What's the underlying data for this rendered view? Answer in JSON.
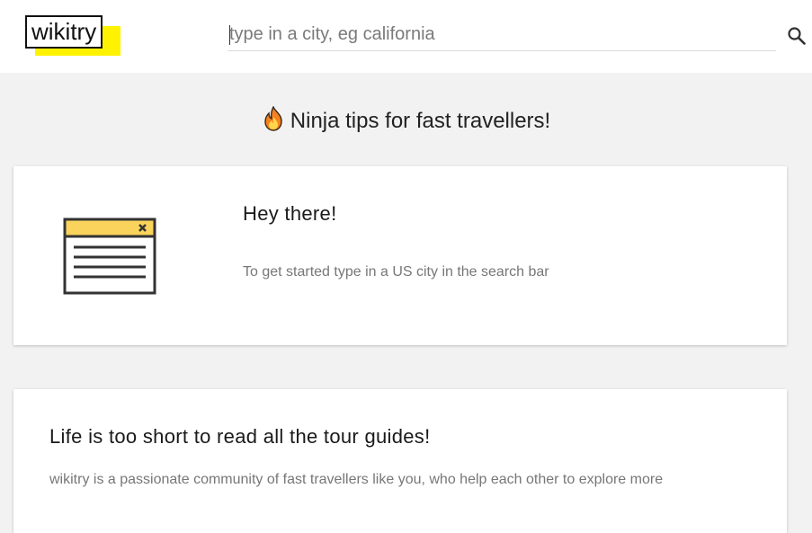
{
  "header": {
    "logo": "wikitry",
    "search_placeholder": "type in a city, eg california",
    "search_icon": "search-icon"
  },
  "main": {
    "tips_title": "Ninja tips for fast travellers!",
    "tips_icon": "fire-icon",
    "cards": [
      {
        "icon": "browser-window-icon",
        "heading": "Hey there!",
        "text": "To get started type in a US city in the search bar"
      },
      {
        "heading": "Life is too short to read all the tour guides!",
        "text": "wikitry is a passionate community of fast travellers like you, who help each other to explore more"
      }
    ]
  },
  "colors": {
    "page_background": "#f2f2f2",
    "header_background": "#ffffff",
    "logo_highlight": "#fff200",
    "window_icon_bar": "#f9d35b",
    "window_icon_stroke": "#333333"
  }
}
